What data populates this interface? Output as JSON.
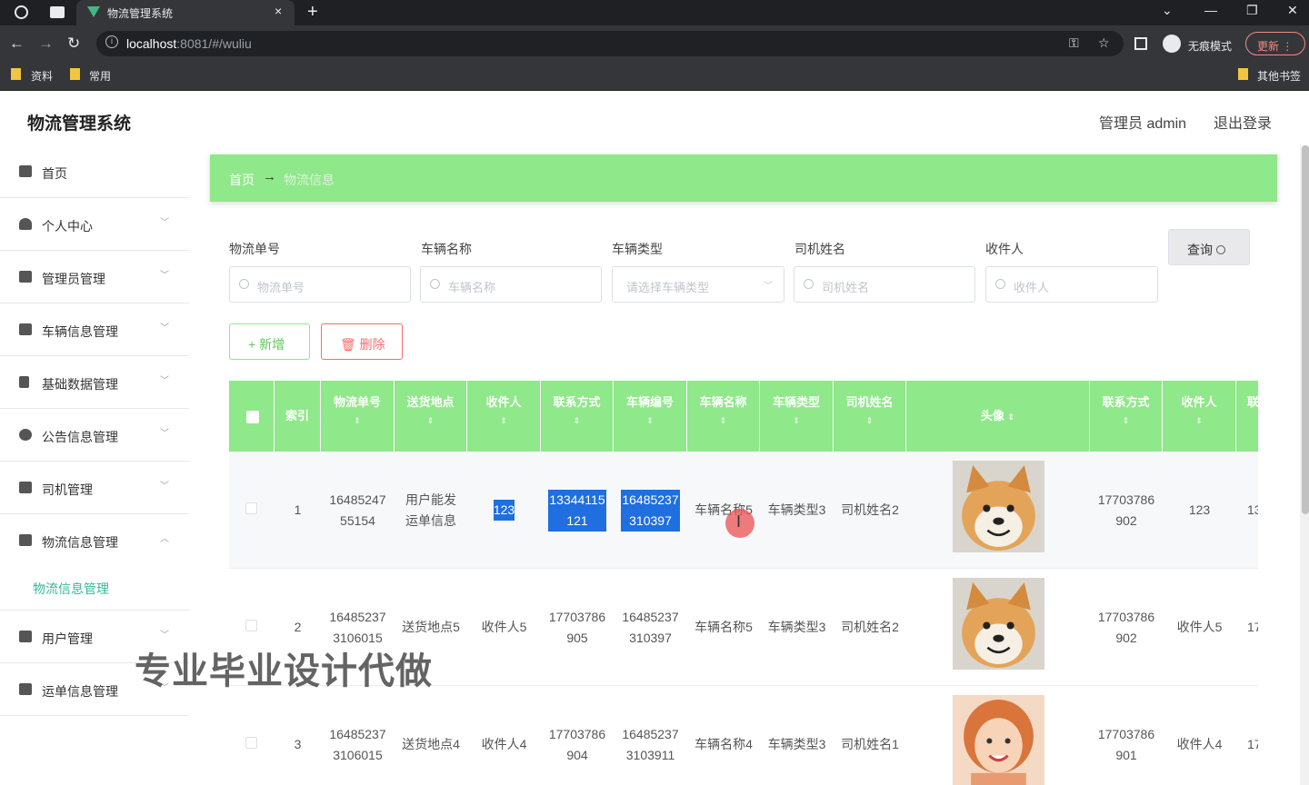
{
  "browser": {
    "tab_title": "物流管理系统",
    "tab_close": "×",
    "new_tab": "+",
    "url_host": "localhost",
    "url_rest": ":8081/#/wuliu",
    "incognito": "无痕模式",
    "update": "更新 ⋮",
    "bookmarks": [
      "资料",
      "常用"
    ],
    "other_bookmarks": "其他书签"
  },
  "header": {
    "title": "物流管理系统",
    "user": "管理员 admin",
    "logout": "退出登录"
  },
  "sidebar": {
    "items": [
      {
        "label": "首页",
        "icon": "home-icon"
      },
      {
        "label": "个人中心",
        "icon": "user-icon"
      },
      {
        "label": "管理员管理",
        "icon": "briefcase-icon"
      },
      {
        "label": "车辆信息管理",
        "icon": "chat-icon"
      },
      {
        "label": "基础数据管理",
        "icon": "flag-icon"
      },
      {
        "label": "公告信息管理",
        "icon": "bulb-icon"
      },
      {
        "label": "司机管理",
        "icon": "send-icon"
      },
      {
        "label": "物流信息管理",
        "icon": "monitor-icon"
      },
      {
        "label": "用户管理",
        "icon": "chart-icon"
      },
      {
        "label": "运单信息管理",
        "icon": "ticket-icon"
      }
    ],
    "sub_item": "物流信息管理"
  },
  "breadcrumb": {
    "home": "首页",
    "arrow": "→",
    "current": "物流信息"
  },
  "filters": {
    "labels": [
      "物流单号",
      "车辆名称",
      "车辆类型",
      "司机姓名",
      "收件人"
    ],
    "placeholders": [
      "物流单号",
      "车辆名称",
      "请选择车辆类型",
      "司机姓名",
      "收件人"
    ]
  },
  "buttons": {
    "query": "查询",
    "add": "+ 新增",
    "delete": "删除"
  },
  "table": {
    "headers": [
      "索引",
      "物流单号",
      "送货地点",
      "收件人",
      "联系方式",
      "车辆编号",
      "车辆名称",
      "车辆类型",
      "司机姓名",
      "头像",
      "联系方式",
      "收件人",
      "联"
    ],
    "sort_glyph": "⇕",
    "rows": [
      {
        "index": "1",
        "no": "1648524755154",
        "place": "用户能发运单信息",
        "receiver": "123",
        "phone": "13344115121",
        "car_no": "16485237310397",
        "car_name": "车辆名称5",
        "car_type": "车辆类型3",
        "driver": "司机姓名2",
        "phone2": "17703786902",
        "receiver2": "123",
        "more": "13"
      },
      {
        "index": "2",
        "no": "164852373106015",
        "place": "送货地点5",
        "receiver": "收件人5",
        "phone": "17703786905",
        "car_no": "16485237310397",
        "car_name": "车辆名称5",
        "car_type": "车辆类型3",
        "driver": "司机姓名2",
        "phone2": "17703786902",
        "receiver2": "收件人5",
        "more": "17"
      },
      {
        "index": "3",
        "no": "164852373106015",
        "place": "送货地点4",
        "receiver": "收件人4",
        "phone": "17703786904",
        "car_no": "164852373103911",
        "car_name": "车辆名称4",
        "car_type": "车辆类型3",
        "driver": "司机姓名1",
        "phone2": "17703786901",
        "receiver2": "收件人4",
        "more": "17"
      }
    ]
  },
  "watermark": "专业毕业设计代做",
  "colors": {
    "accent_green": "#8fe88a",
    "sub_active": "#35b99a",
    "danger": "#f56c6c",
    "selection": "#1f6fe0"
  }
}
